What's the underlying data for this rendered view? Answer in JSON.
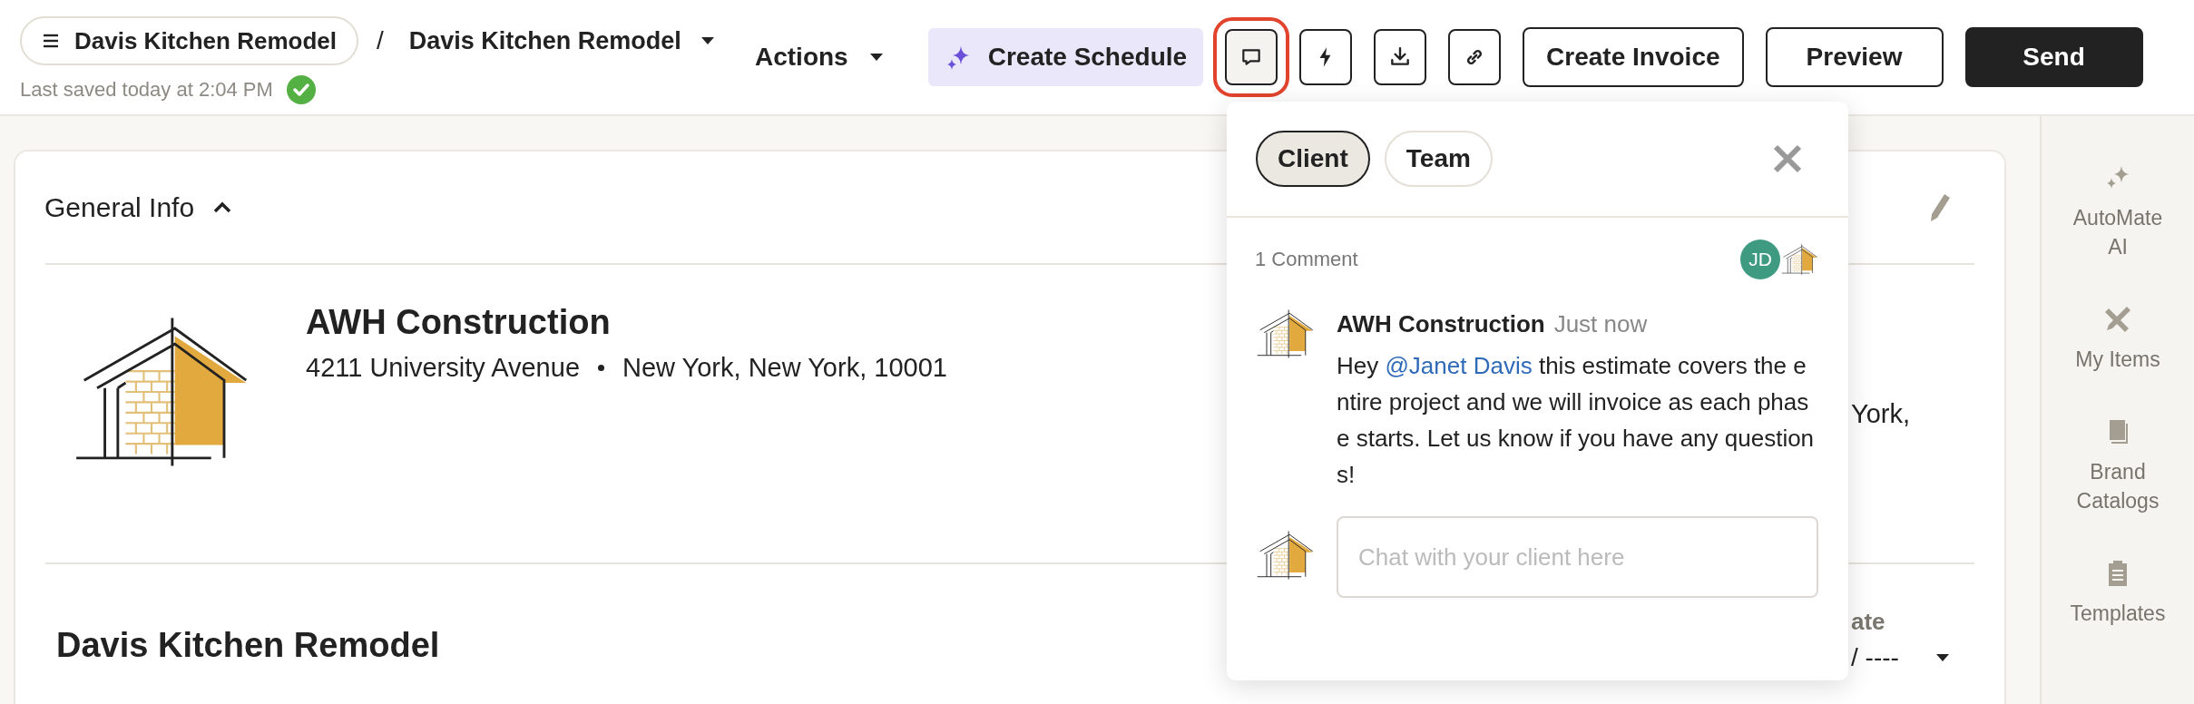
{
  "header": {
    "menu_button": "Davis Kitchen Remodel",
    "separator": "/",
    "breadcrumb": "Davis Kitchen Remodel",
    "last_saved": "Last saved today at 2:04 PM",
    "saved": true,
    "actions": "Actions",
    "create_schedule": "Create Schedule",
    "icon_buttons": [
      {
        "kind": "comment",
        "highlighted": true
      },
      {
        "kind": "lightning",
        "highlighted": false
      },
      {
        "kind": "download",
        "highlighted": false
      },
      {
        "kind": "link",
        "highlighted": false
      }
    ],
    "buttons": [
      {
        "label": "Create Invoice",
        "kind": "outline"
      },
      {
        "label": "Preview",
        "kind": "outline"
      },
      {
        "label": "Send",
        "kind": "primary"
      }
    ]
  },
  "general_info": {
    "title": "General Info",
    "expanded": true,
    "company": "AWH Construction",
    "street": "4211 University Avenue",
    "city": "New York, New York, 10001",
    "partial_text": "York,"
  },
  "project": {
    "title": "Davis Kitchen Remodel",
    "date_label": "ate",
    "date_value": "/ ----"
  },
  "comments_panel": {
    "tabs": [
      {
        "label": "Client",
        "selected": true
      },
      {
        "label": "Team",
        "selected": false
      }
    ],
    "count": "1 Comment",
    "participants": [
      {
        "kind": "initials",
        "initials": "JD"
      },
      {
        "kind": "logo"
      }
    ],
    "comments": [
      {
        "author": "AWH Construction",
        "time": "Just now",
        "text_before": "Hey ",
        "mention": "@Janet Davis",
        "text_after": " this estimate covers the entire project and we will invoice as each phase starts. Let us know if you have any questions!"
      }
    ],
    "placeholder": "Chat with your client here"
  },
  "sidebar": {
    "items": [
      {
        "kind": "sparkle",
        "label": "AutoMate AI"
      },
      {
        "kind": "tools",
        "label": "My Items"
      },
      {
        "kind": "book",
        "label": "Brand Catalogs"
      },
      {
        "kind": "clipboard",
        "label": "Templates"
      }
    ]
  }
}
